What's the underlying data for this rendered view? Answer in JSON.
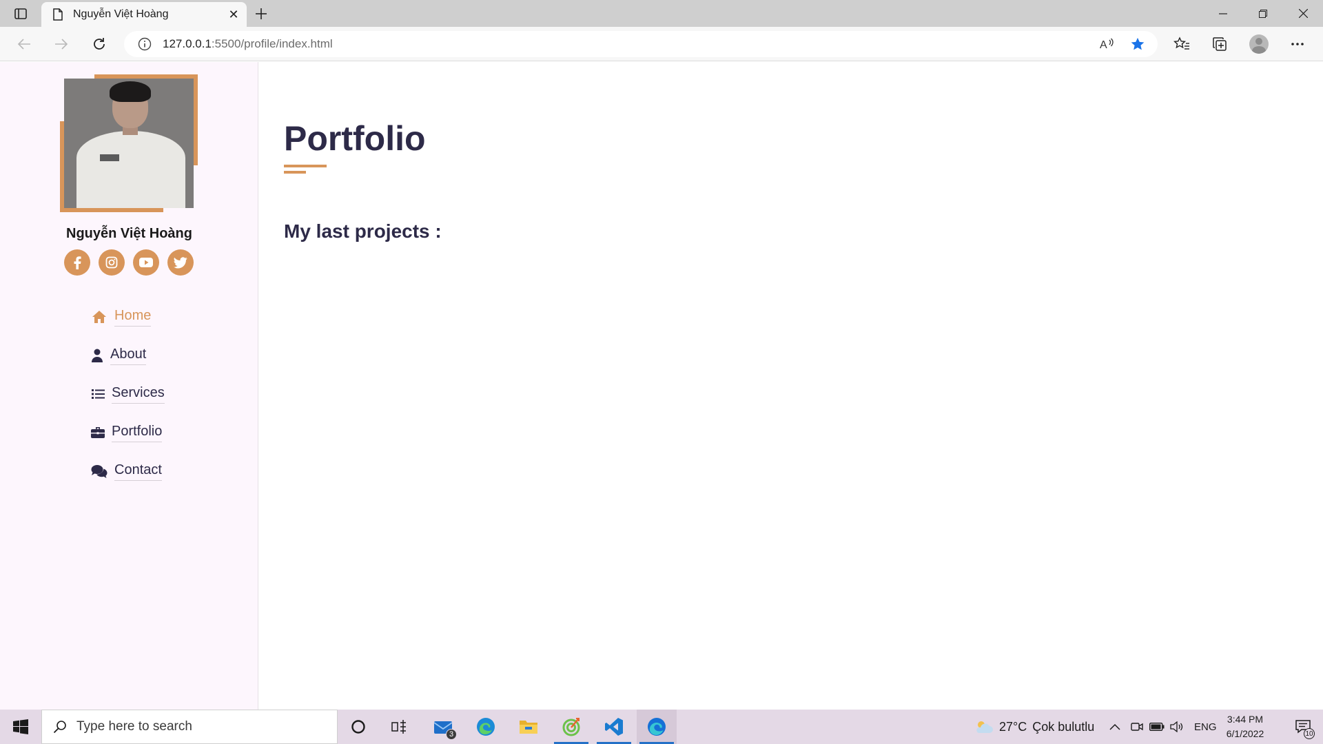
{
  "browser": {
    "tab_title": "Nguyễn Việt Hoàng",
    "url_host": "127.0.0.1",
    "url_path": ":5500/profile/index.html",
    "accent_color": "#1a73e8"
  },
  "sidebar": {
    "profile_name": "Nguyễn Việt Hoàng",
    "social": [
      {
        "icon": "facebook-icon"
      },
      {
        "icon": "instagram-icon"
      },
      {
        "icon": "youtube-icon"
      },
      {
        "icon": "twitter-icon"
      }
    ],
    "nav": [
      {
        "label": "Home",
        "icon": "home-icon",
        "active": true
      },
      {
        "label": "About",
        "icon": "user-icon",
        "active": false
      },
      {
        "label": "Services",
        "icon": "list-icon",
        "active": false
      },
      {
        "label": "Portfolio",
        "icon": "briefcase-icon",
        "active": false
      },
      {
        "label": "Contact",
        "icon": "comments-icon",
        "active": false
      }
    ],
    "accent_color": "#d8955a",
    "background_color": "#fdf6fd"
  },
  "main": {
    "title": "Portfolio",
    "section_heading": "My last projects :",
    "text_color": "#2d2a48"
  },
  "taskbar": {
    "search_placeholder": "Type here to search",
    "mail_badge": "3",
    "weather_temp": "27°C",
    "weather_desc": "Çok bulutlu",
    "language": "ENG",
    "time": "3:44 PM",
    "date": "6/1/2022",
    "notification_count": "10"
  }
}
